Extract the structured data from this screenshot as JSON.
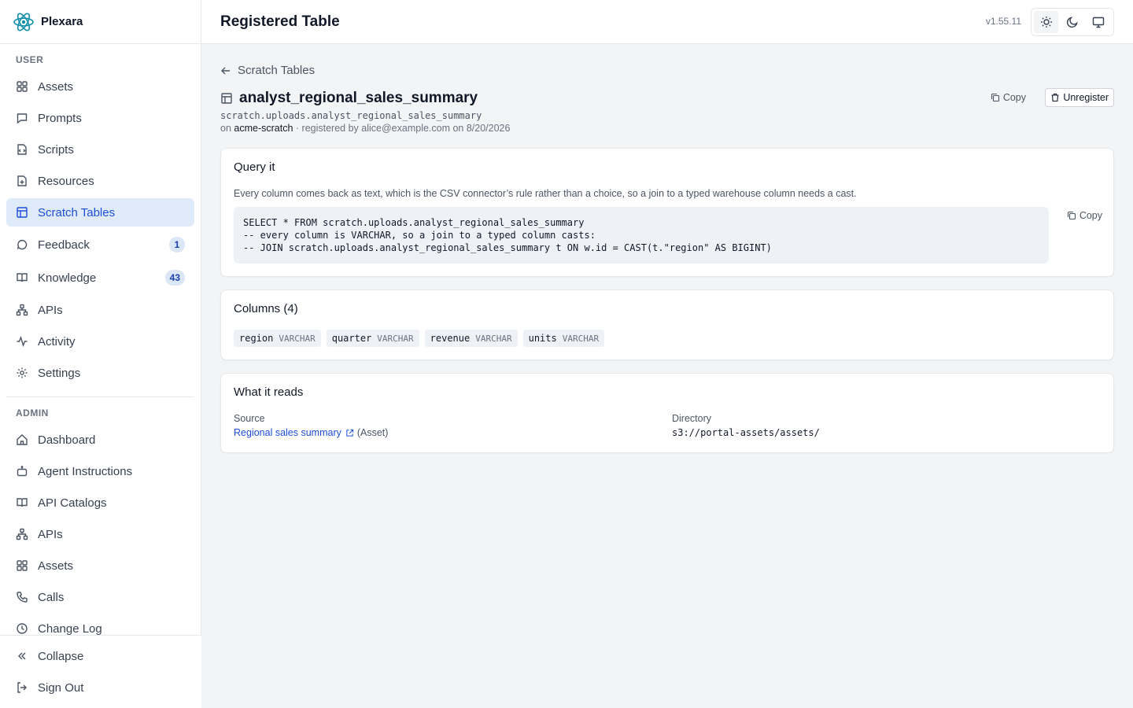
{
  "brand": {
    "name": "Plexara",
    "accent": "#0f8fa8"
  },
  "sidebar": {
    "user_label": "USER",
    "user_items": [
      {
        "label": "Assets",
        "icon": "grid-icon"
      },
      {
        "label": "Prompts",
        "icon": "message-icon"
      },
      {
        "label": "Scripts",
        "icon": "terminal-icon"
      },
      {
        "label": "Resources",
        "icon": "file-plus-icon"
      },
      {
        "label": "Scratch Tables",
        "icon": "table-icon",
        "active": true
      },
      {
        "label": "Feedback",
        "icon": "chat-icon",
        "badge": "1"
      },
      {
        "label": "Knowledge",
        "icon": "book-icon",
        "badge": "43"
      },
      {
        "label": "APIs",
        "icon": "network-icon"
      },
      {
        "label": "Activity",
        "icon": "activity-icon"
      },
      {
        "label": "Settings",
        "icon": "gear-icon"
      }
    ],
    "admin_label": "ADMIN",
    "admin_items": [
      {
        "label": "Dashboard",
        "icon": "home-icon"
      },
      {
        "label": "Agent Instructions",
        "icon": "bot-icon"
      },
      {
        "label": "API Catalogs",
        "icon": "book-open-icon"
      },
      {
        "label": "APIs",
        "icon": "network-icon"
      },
      {
        "label": "Assets",
        "icon": "grid-icon"
      },
      {
        "label": "Calls",
        "icon": "phone-icon"
      },
      {
        "label": "Change Log",
        "icon": "clock-icon"
      }
    ],
    "collapse_label": "Collapse",
    "signout_label": "Sign Out"
  },
  "header": {
    "title": "Registered Table",
    "version": "v1.55.11"
  },
  "page": {
    "back_label": "Scratch Tables",
    "table_name": "analyst_regional_sales_summary",
    "fqn": "scratch.uploads.analyst_regional_sales_summary",
    "meta_on": "on",
    "connection": "acme-scratch",
    "meta_rest": "· registered by alice@example.com on 8/20/2026",
    "copy_label": "Copy",
    "unregister_label": "Unregister"
  },
  "query": {
    "title": "Query it",
    "description": "Every column comes back as text, which is the CSV connector’s rule rather than a choice, so a join to a typed warehouse column needs a cast.",
    "code": "SELECT * FROM scratch.uploads.analyst_regional_sales_summary\n-- every column is VARCHAR, so a join to a typed column casts:\n-- JOIN scratch.uploads.analyst_regional_sales_summary t ON w.id = CAST(t.\"region\" AS BIGINT)",
    "copy_label": "Copy"
  },
  "columns": {
    "title": "Columns (4)",
    "items": [
      {
        "name": "region",
        "type": "VARCHAR"
      },
      {
        "name": "quarter",
        "type": "VARCHAR"
      },
      {
        "name": "revenue",
        "type": "VARCHAR"
      },
      {
        "name": "units",
        "type": "VARCHAR"
      }
    ]
  },
  "reads": {
    "title": "What it reads",
    "source_label": "Source",
    "source_link": "Regional sales summary",
    "source_kind": "(Asset)",
    "directory_label": "Directory",
    "directory_value": "s3://portal-assets/assets/"
  }
}
